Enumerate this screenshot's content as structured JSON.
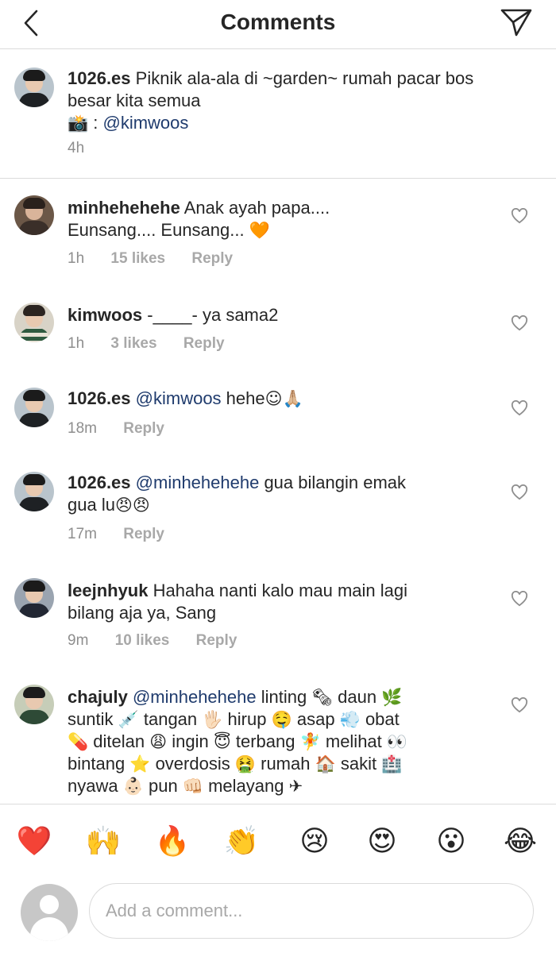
{
  "header": {
    "title": "Comments"
  },
  "caption": {
    "username": "1026.es",
    "text_line1": "Piknik ala-ala di ~garden~ rumah pacar bos",
    "text_line2": "besar kita semua",
    "camera_emoji": "📸",
    "credit_prefix": " : ",
    "credit_mention": "@kimwoos",
    "time": "4h"
  },
  "comments": [
    {
      "username": "minhehehehe",
      "text_line1": "Anak ayah papa....",
      "text_line2": "Eunsang.... Eunsang...",
      "emoji": "🧡",
      "time": "1h",
      "likes": "15 likes",
      "reply": "Reply"
    },
    {
      "username": "kimwoos",
      "text": "-____- ya sama2",
      "time": "1h",
      "likes": "3 likes",
      "reply": "Reply"
    },
    {
      "username": "1026.es",
      "mention": "@kimwoos",
      "text": " hehe",
      "emoji": "☺🙏🏼",
      "time": "18m",
      "reply": "Reply"
    },
    {
      "username": "1026.es",
      "mention": "@minhehehehe",
      "text_line1": " gua bilangin emak",
      "text_line2": "gua lu",
      "emoji": "😠😠",
      "time": "17m",
      "reply": "Reply"
    },
    {
      "username": "leejnhyuk",
      "text_line1": "Hahaha nanti kalo mau main lagi",
      "text_line2": "bilang aja ya, Sang",
      "time": "9m",
      "likes": "10 likes",
      "reply": "Reply"
    },
    {
      "username": "chajuly",
      "mention": "@minhehehehe",
      "words": [
        " linting ",
        "🗞",
        " daun ",
        "🌿",
        "suntik ",
        "💉",
        " tangan ",
        "🖐🏻",
        " hirup ",
        "🤤",
        " asap ",
        "💨",
        " obat",
        "💊",
        " ditelan ",
        "😩",
        " ingin ",
        "😇",
        " terbang ",
        "🧚",
        " melihat ",
        "👀",
        "bintang ",
        "⭐",
        " overdosis ",
        "🤮",
        " rumah ",
        "🏠",
        " sakit ",
        "🏥",
        "nyawa ",
        "👶🏻",
        " pun ",
        "👊🏻",
        " melayang ",
        "✈"
      ]
    }
  ],
  "emoji_bar": [
    "❤️",
    "🙌",
    "🔥",
    "👏",
    "😢",
    "😍",
    "😮",
    "😂"
  ],
  "composer": {
    "placeholder": "Add a comment..."
  },
  "colors": {
    "mention": "#1f3b6d",
    "muted": "#8e8e8e",
    "border": "#dbdbdb",
    "text": "#262626"
  },
  "icons": [
    "back-chevron-icon",
    "send-direct-icon",
    "heart-outline-icon"
  ]
}
